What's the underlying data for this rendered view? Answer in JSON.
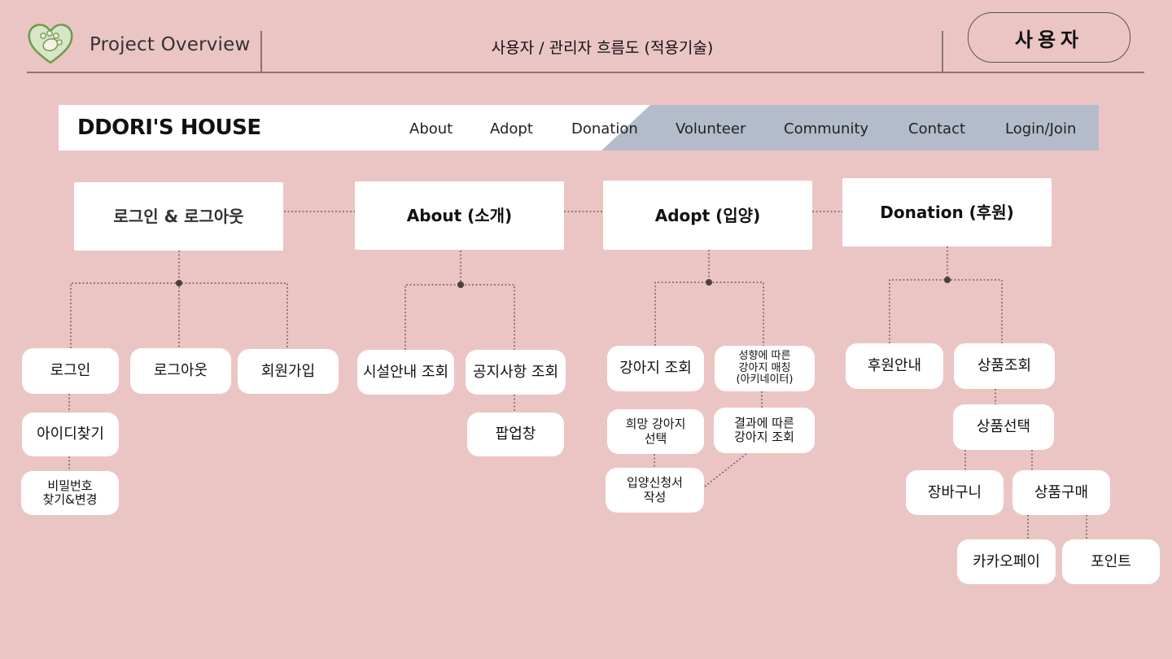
{
  "header": {
    "project_title": "Project Overview",
    "subtitle": "사용자 / 관리자 흐름도 (적용기술)",
    "role_badge": "사용자",
    "logo_icon": "paw-heart-icon"
  },
  "navbar": {
    "brand": "DDORI'S HOUSE",
    "items": [
      "About",
      "Adopt",
      "Donation",
      "Volunteer",
      "Community",
      "Contact",
      "Login/Join"
    ],
    "accent_color": "#b4bccb"
  },
  "diagram": {
    "categories": [
      "로그인 & 로그아웃",
      "About (소개)",
      "Adopt (입양)",
      "Donation (후원)"
    ],
    "login": {
      "login": "로그인",
      "logout": "로그아웃",
      "signup": "회원가입",
      "find_id": "아이디찾기",
      "find_pw_line1": "비밀번호",
      "find_pw_line2": "찾기&변경"
    },
    "about": {
      "facility": "시설안내 조회",
      "notice": "공지사항 조회",
      "popup": "팝업창"
    },
    "adopt": {
      "dog_search": "강아지 조회",
      "match_line1": "성향에 따른",
      "match_line2": "강아지 매칭",
      "match_line3": "(아키네이터)",
      "wish_line1": "희망 강아지",
      "wish_line2": "선택",
      "result_line1": "결과에 따른",
      "result_line2": "강아지 조회",
      "apply_line1": "입양신청서",
      "apply_line2": "작성"
    },
    "donation": {
      "guide": "후원안내",
      "product_search": "상품조회",
      "product_select": "상품선택",
      "cart": "장바구니",
      "purchase": "상품구매",
      "kakaopay": "카카오페이",
      "point": "포인트"
    }
  }
}
